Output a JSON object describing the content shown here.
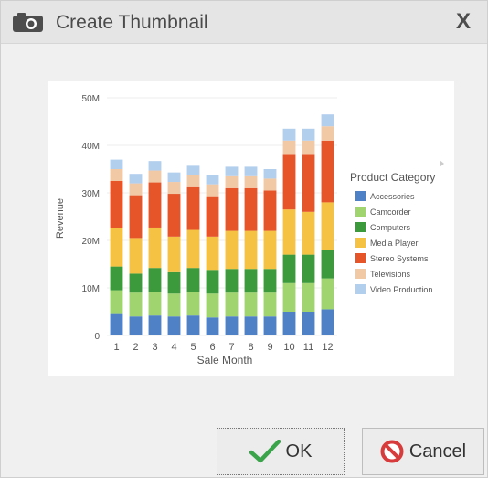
{
  "dialog": {
    "title": "Create Thumbnail",
    "close_label": "X",
    "ok_label": "OK",
    "cancel_label": "Cancel"
  },
  "icons": {
    "title": "camera-icon",
    "ok": "checkmark-icon",
    "cancel": "prohibited-icon"
  },
  "colors": {
    "ok_check": "#3aa44a",
    "cancel_icon": "#d83b3b"
  },
  "chart_data": {
    "type": "bar",
    "stacked": true,
    "xlabel": "Sale Month",
    "ylabel": "Revenue",
    "ylim": [
      0,
      50
    ],
    "yticks": [
      "0",
      "10M",
      "20M",
      "30M",
      "40M",
      "50M"
    ],
    "categories": [
      "1",
      "2",
      "3",
      "4",
      "5",
      "6",
      "7",
      "8",
      "9",
      "10",
      "11",
      "12"
    ],
    "legend_title": "Product Category",
    "legend_position": "right",
    "series": [
      {
        "name": "Accessories",
        "color": "#4f81c7",
        "values": [
          4.5,
          4,
          4.2,
          4,
          4.2,
          3.8,
          4,
          4,
          4,
          5,
          5,
          5.5
        ]
      },
      {
        "name": "Camcorder",
        "color": "#9fd46e",
        "values": [
          5,
          5,
          5,
          4.8,
          5,
          5,
          5,
          5,
          5,
          6,
          6,
          6.5
        ]
      },
      {
        "name": "Computers",
        "color": "#3c9a3c",
        "values": [
          5,
          4,
          5,
          4.5,
          5,
          5,
          5,
          5,
          5,
          6,
          6,
          6
        ]
      },
      {
        "name": "Media Player",
        "color": "#f5c243",
        "values": [
          8,
          7.5,
          8.5,
          7.5,
          8,
          7,
          8,
          8,
          8,
          9.5,
          9,
          10
        ]
      },
      {
        "name": "Stereo Systems",
        "color": "#e55529",
        "values": [
          10,
          9,
          9.5,
          9,
          9,
          8.5,
          9,
          9,
          8.5,
          11.5,
          12,
          13
        ]
      },
      {
        "name": "Televisions",
        "color": "#f2c9a5",
        "values": [
          2.5,
          2.5,
          2.5,
          2.5,
          2.5,
          2.5,
          2.5,
          2.5,
          2.5,
          3,
          3,
          3
        ]
      },
      {
        "name": "Video Production",
        "color": "#b3cfee",
        "values": [
          2,
          2,
          2,
          2,
          2,
          2,
          2,
          2,
          2,
          2.5,
          2.5,
          2.5
        ]
      }
    ]
  }
}
